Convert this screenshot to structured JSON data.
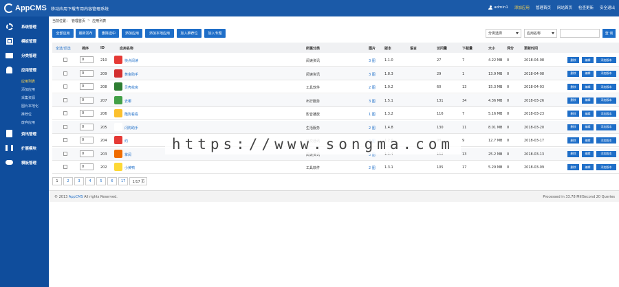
{
  "header": {
    "logo_text": "AppCMS",
    "app_title": "移动应用下载专用内容管理系统",
    "nav": [
      {
        "label": "admin1",
        "accent": false
      },
      {
        "label": "添加应用",
        "accent": true
      },
      {
        "label": "管理首页",
        "accent": false
      },
      {
        "label": "网站首页",
        "accent": false
      },
      {
        "label": "检查更新",
        "accent": false
      },
      {
        "label": "安全退出",
        "accent": false
      }
    ]
  },
  "sidebar": {
    "groups": [
      {
        "label": "系统管理",
        "icon": "gear-icon"
      },
      {
        "label": "模板管理",
        "icon": "grid-icon"
      },
      {
        "label": "分类管理",
        "icon": "folder-icon"
      },
      {
        "label": "应用管理",
        "icon": "android-icon"
      },
      {
        "label": "资讯管理",
        "icon": "document-icon"
      },
      {
        "label": "扩展模块",
        "icon": "tools-icon"
      },
      {
        "label": "模板管理",
        "icon": "cloud-icon"
      }
    ],
    "app_sub_items": [
      {
        "label": "应用列表",
        "active": true
      },
      {
        "label": "添加应用",
        "active": false
      },
      {
        "label": "采集资源",
        "active": false
      },
      {
        "label": "图片本地化",
        "active": false
      },
      {
        "label": "推荐位",
        "active": false
      },
      {
        "label": "废弃应用",
        "active": false
      }
    ]
  },
  "breadcrumb": {
    "prefix": "当前位置：",
    "home": "管理首页",
    "separator": ">",
    "current": "应用列表"
  },
  "toolbar": {
    "buttons": [
      "全部应用",
      "最新发布",
      "删除选中",
      "添加应用",
      "添加本地应用",
      "加入推荐位",
      "加入专题"
    ],
    "filter_category": "分类选择",
    "filter_field": "应用名称",
    "search_placeholder": "",
    "search_button": "查 询"
  },
  "table": {
    "headers": {
      "select": "全选/反选",
      "sort": "排序",
      "id": "ID",
      "name": "应用名称",
      "category": "所属分类",
      "images": "图片",
      "version": "版本",
      "size_lang": "语言",
      "views": "访问量",
      "downloads": "下载量",
      "size": "大小",
      "rating": "评分",
      "updated": "更新时间"
    },
    "actions": [
      "删除",
      "编辑",
      "添加版本"
    ],
    "rows": [
      {
        "sort": "0",
        "id": "210",
        "name": "快点阅读",
        "category": "阅读资讯",
        "images": "3 图",
        "version": "1.1.0",
        "views": "27",
        "downloads": "7",
        "size": "4.22 MB",
        "rating": "0",
        "updated": "2018-04-08",
        "icon_color": "#e53935"
      },
      {
        "sort": "0",
        "id": "209",
        "name": "黄金助手",
        "category": "阅读资讯",
        "images": "3 图",
        "version": "1.8.3",
        "views": "29",
        "downloads": "1",
        "size": "13.9 MB",
        "rating": "0",
        "updated": "2018-04-08",
        "icon_color": "#d32f2f"
      },
      {
        "sort": "0",
        "id": "208",
        "name": "贝壳找房",
        "category": "工具软件",
        "images": "2 图",
        "version": "1.0.2",
        "views": "60",
        "downloads": "13",
        "size": "15.3 MB",
        "rating": "0",
        "updated": "2018-04-03",
        "icon_color": "#2e7d32"
      },
      {
        "sort": "0",
        "id": "207",
        "name": "去哪",
        "category": "出行服务",
        "images": "3 图",
        "version": "1.5.1",
        "views": "131",
        "downloads": "34",
        "size": "4.36 MB",
        "rating": "0",
        "updated": "2018-03-26",
        "icon_color": "#43a047"
      },
      {
        "sort": "0",
        "id": "206",
        "name": "酷狗看看",
        "category": "影音播放",
        "images": "1 图",
        "version": "1.3.2",
        "views": "116",
        "downloads": "7",
        "size": "5.16 MB",
        "rating": "0",
        "updated": "2018-03-23",
        "icon_color": "#fbc02d"
      },
      {
        "sort": "0",
        "id": "205",
        "name": "闪购助手",
        "category": "生活服务",
        "images": "2 图",
        "version": "1.4.8",
        "views": "130",
        "downloads": "11",
        "size": "8.01 MB",
        "rating": "0",
        "updated": "2018-03-20",
        "icon_color": "#ffffff"
      },
      {
        "sort": "0",
        "id": "204",
        "name": "约",
        "category": "社交通讯",
        "images": "2 图",
        "version": "1.2.0",
        "views": "98",
        "downloads": "9",
        "size": "12.7 MB",
        "rating": "0",
        "updated": "2018-03-17",
        "icon_color": "#e53935"
      },
      {
        "sort": "0",
        "id": "203",
        "name": "掌阅",
        "category": "阅读资讯",
        "images": "5 图",
        "version": "1.1.4",
        "views": "152",
        "downloads": "13",
        "size": "25.2 MB",
        "rating": "0",
        "updated": "2018-03-13",
        "icon_color": "#ef6c00"
      },
      {
        "sort": "0",
        "id": "202",
        "name": "小黄鸭",
        "category": "工具软件",
        "images": "2 图",
        "version": "1.3.1",
        "views": "105",
        "downloads": "17",
        "size": "5.29 MB",
        "rating": "0",
        "updated": "2018-03-09",
        "icon_color": "#fdd835"
      }
    ]
  },
  "pagination": {
    "pages": [
      "1",
      "2",
      "3",
      "4",
      "5",
      "6",
      "17"
    ],
    "current": "1",
    "info": "1/17 页"
  },
  "footer": {
    "copyright_prefix": "© 2013",
    "brand": "AppCMS",
    "copyright_suffix": "All rights Reserved.",
    "processed": "Processed in 33.78 MillSecond 20 Queries"
  },
  "watermark": "https://www.songma.com",
  "colors": {
    "topbar": "#1b5aa8",
    "sidebar": "#0f4d9c",
    "accent_button": "#1e6ec8",
    "highlight": "#ffd54a"
  }
}
